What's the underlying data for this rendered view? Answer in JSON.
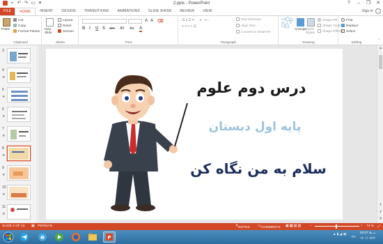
{
  "window": {
    "title": "2.pptx - PowerPoint",
    "controls": [
      "?",
      "–",
      "❐",
      "✕"
    ],
    "signin": "Sign in"
  },
  "tabs": [
    {
      "label": "FILE",
      "active": false
    },
    {
      "label": "HOME",
      "active": true
    },
    {
      "label": "INSERT",
      "active": false
    },
    {
      "label": "DESIGN",
      "active": false
    },
    {
      "label": "TRANSITIONS",
      "active": false
    },
    {
      "label": "ANIMATIONS",
      "active": false
    },
    {
      "label": "SLIDE SHOW",
      "active": false
    },
    {
      "label": "REVIEW",
      "active": false
    },
    {
      "label": "VIEW",
      "active": false
    }
  ],
  "ribbon": {
    "clipboard": {
      "paste": "Paste",
      "cut": "Cut",
      "copy": "Copy",
      "format_painter": "Format Painter",
      "label": "Clipboard"
    },
    "slides": {
      "new_slide": "New Slide",
      "layout": "Layout",
      "reset": "Reset",
      "section": "Section",
      "label": "Slides"
    },
    "font": {
      "label": "Font",
      "buttons": [
        "B",
        "I",
        "U",
        "S",
        "abc",
        "AV",
        "Aa",
        "A"
      ]
    },
    "paragraph": {
      "text_direction": "Text Direction",
      "align_text": "Align Text",
      "convert_smartart": "Convert to SmartArt",
      "label": "Paragraph"
    },
    "drawing": {
      "arrange": "Arrange",
      "quick_styles": "Quick Styles",
      "shape_fill": "Shape Fill",
      "shape_outline": "Shape Outline",
      "shape_effects": "Shape Effects",
      "label": "Drawing"
    },
    "editing": {
      "find": "Find",
      "replace": "Replace",
      "select": "Select",
      "label": "Editing"
    }
  },
  "thumbnails": [
    {
      "num": "3",
      "star": "★"
    },
    {
      "num": "4",
      "star": "★"
    },
    {
      "num": "5",
      "star": "★"
    },
    {
      "num": "6",
      "star": "★"
    },
    {
      "num": "7",
      "star": "★"
    },
    {
      "num": "8",
      "star": "★"
    },
    {
      "num": "9",
      "star": "★"
    },
    {
      "num": "10",
      "star": "★"
    },
    {
      "num": "11",
      "star": "★"
    }
  ],
  "slide": {
    "title": "درس دوم علوم",
    "subtitle": "پایه اول دبستان",
    "body": "سلام به من نگاه کن"
  },
  "statusbar": {
    "slide_info": "SLIDE 2 OF 10",
    "language": "PERSIAN",
    "notes": "NOTES",
    "comments": "COMMENTS",
    "zoom": "74 %"
  },
  "taskbar": {
    "lang": "FA",
    "time": "02:07 ب.ظ",
    "date": "۱۴۰۱/۰۷/۲۲"
  },
  "colors": {
    "accent": "#d24726",
    "taskbar": "#3a7db0"
  }
}
